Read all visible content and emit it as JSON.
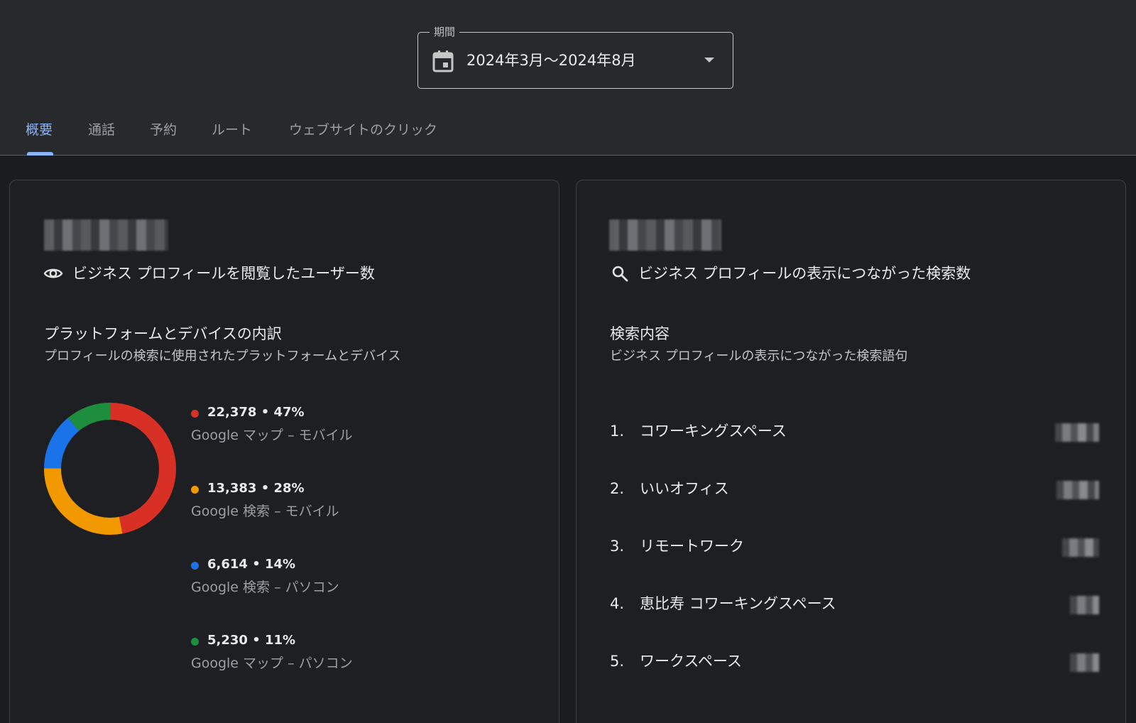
{
  "header": {
    "period_label": "期間",
    "period_value": "2024年3月〜2024年8月",
    "tabs": [
      {
        "label": "概要",
        "active": true
      },
      {
        "label": "通話",
        "active": false
      },
      {
        "label": "予約",
        "active": false
      },
      {
        "label": "ルート",
        "active": false
      },
      {
        "label": "ウェブサイトのクリック",
        "active": false
      }
    ]
  },
  "left_card": {
    "metric_title": "ビジネス プロフィールを閲覧したユーザー数",
    "breakdown_title": "プラットフォームとデバイスの内訳",
    "breakdown_subtitle": "プロフィールの検索に使用されたプラットフォームとデバイス",
    "icon": "eye-icon"
  },
  "chart_data": {
    "type": "pie",
    "donut": true,
    "series": [
      {
        "name": "Google マップ – モバイル",
        "value": 22378,
        "percent": 47,
        "display": "22,378 • 47%",
        "color": "#d93025"
      },
      {
        "name": "Google 検索 – モバイル",
        "value": 13383,
        "percent": 28,
        "display": "13,383 • 28%",
        "color": "#f29900"
      },
      {
        "name": "Google 検索 – パソコン",
        "value": 6614,
        "percent": 14,
        "display": "6,614 • 14%",
        "color": "#1a73e8"
      },
      {
        "name": "Google マップ – パソコン",
        "value": 5230,
        "percent": 11,
        "display": "5,230 • 11%",
        "color": "#1e8e3e"
      }
    ]
  },
  "right_card": {
    "metric_title": "ビジネス プロフィールの表示につながった検索数",
    "search_title": "検索内容",
    "search_subtitle": "ビジネス プロフィールの表示につながった検索語句",
    "icon": "search-icon",
    "terms": [
      {
        "rank": "1.",
        "text": "コワーキングスペース"
      },
      {
        "rank": "2.",
        "text": "いいオフィス"
      },
      {
        "rank": "3.",
        "text": "リモートワーク"
      },
      {
        "rank": "4.",
        "text": "恵比寿 コワーキングスペース"
      },
      {
        "rank": "5.",
        "text": "ワークスペース"
      }
    ]
  }
}
